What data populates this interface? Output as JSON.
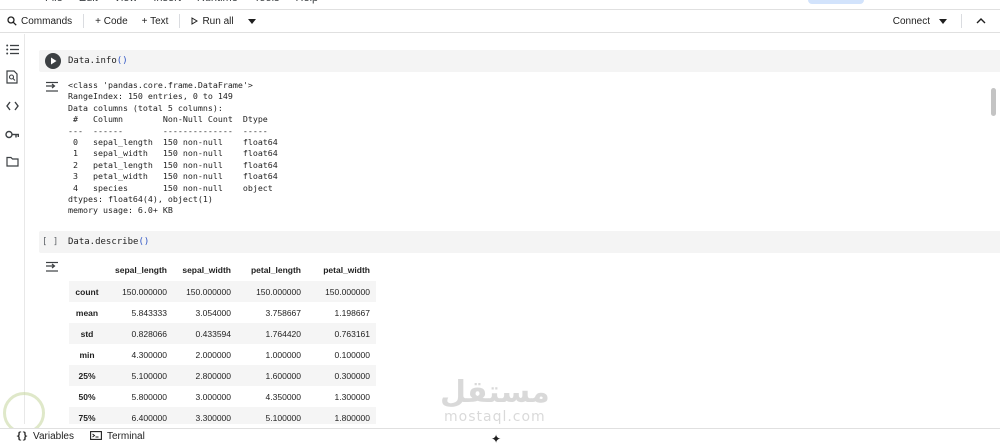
{
  "menu": {
    "items": [
      "File",
      "Edit",
      "View",
      "Insert",
      "Runtime",
      "Tools",
      "Help"
    ]
  },
  "toolbar": {
    "commands_label": "Commands",
    "code_label": "+ Code",
    "text_label": "+ Text",
    "run_all_label": "Run all",
    "connect_label": "Connect"
  },
  "rail": {
    "icons": [
      "table-of-contents-icon",
      "find-icon",
      "code-snippets-icon",
      "secrets-key-icon",
      "files-folder-icon"
    ]
  },
  "cells": [
    {
      "code_name": "Data.info",
      "code_parens": "()",
      "output_lines": [
        "<class 'pandas.core.frame.DataFrame'>",
        "RangeIndex: 150 entries, 0 to 149",
        "Data columns (total 5 columns):",
        " #   Column        Non-Null Count  Dtype  ",
        "---  ------        --------------  -----  ",
        " 0   sepal_length  150 non-null    float64",
        " 1   sepal_width   150 non-null    float64",
        " 2   petal_length  150 non-null    float64",
        " 3   petal_width   150 non-null    float64",
        " 4   species       150 non-null    object ",
        "dtypes: float64(4), object(1)",
        "memory usage: 6.0+ KB"
      ]
    },
    {
      "exec_marker": "[ ]",
      "code_name": "Data.describe",
      "code_parens": "()",
      "table": {
        "columns": [
          "sepal_length",
          "sepal_width",
          "petal_length",
          "petal_width"
        ],
        "rows": [
          {
            "label": "count",
            "values": [
              "150.000000",
              "150.000000",
              "150.000000",
              "150.000000"
            ]
          },
          {
            "label": "mean",
            "values": [
              "5.843333",
              "3.054000",
              "3.758667",
              "1.198667"
            ]
          },
          {
            "label": "std",
            "values": [
              "0.828066",
              "0.433594",
              "1.764420",
              "0.763161"
            ]
          },
          {
            "label": "min",
            "values": [
              "4.300000",
              "2.000000",
              "1.000000",
              "0.100000"
            ]
          },
          {
            "label": "25%",
            "values": [
              "5.100000",
              "2.800000",
              "1.600000",
              "0.300000"
            ]
          },
          {
            "label": "50%",
            "values": [
              "5.800000",
              "3.000000",
              "4.350000",
              "1.300000"
            ]
          },
          {
            "label": "75%",
            "values": [
              "6.400000",
              "3.300000",
              "5.100000",
              "1.800000"
            ]
          }
        ]
      }
    }
  ],
  "statusbar": {
    "variables_label": "Variables",
    "terminal_label": "Terminal"
  },
  "watermark": {
    "arabic": "مستقل",
    "latin": "mostaql.com"
  },
  "colors": {
    "accent_blue": "#2f55c4",
    "run_button": "#3c4043",
    "cell_bg": "#f4f4f4"
  }
}
